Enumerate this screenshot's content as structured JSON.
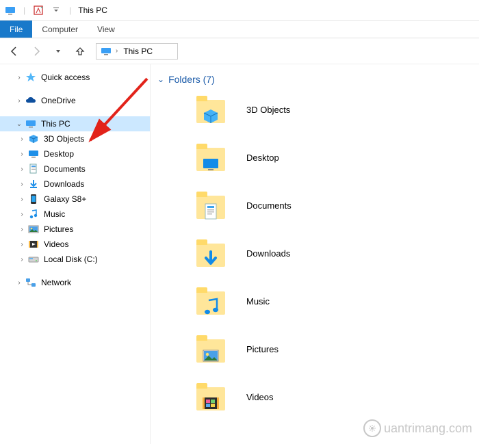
{
  "titlebar": {
    "title": "This PC"
  },
  "ribbon": {
    "file": "File",
    "tabs": [
      "Computer",
      "View"
    ]
  },
  "address": {
    "crumb": "This PC"
  },
  "tree": {
    "quick_access": "Quick access",
    "onedrive": "OneDrive",
    "this_pc": "This PC",
    "children": [
      {
        "label": "3D Objects",
        "icon": "3d"
      },
      {
        "label": "Desktop",
        "icon": "desktop"
      },
      {
        "label": "Documents",
        "icon": "documents"
      },
      {
        "label": "Downloads",
        "icon": "downloads"
      },
      {
        "label": "Galaxy S8+",
        "icon": "phone"
      },
      {
        "label": "Music",
        "icon": "music"
      },
      {
        "label": "Pictures",
        "icon": "pictures"
      },
      {
        "label": "Videos",
        "icon": "videos"
      },
      {
        "label": "Local Disk (C:)",
        "icon": "disk"
      }
    ],
    "network": "Network"
  },
  "content": {
    "section_title": "Folders (7)",
    "folders": [
      {
        "label": "3D Objects",
        "icon": "3d"
      },
      {
        "label": "Desktop",
        "icon": "desktop"
      },
      {
        "label": "Documents",
        "icon": "documents"
      },
      {
        "label": "Downloads",
        "icon": "downloads"
      },
      {
        "label": "Music",
        "icon": "music"
      },
      {
        "label": "Pictures",
        "icon": "pictures"
      },
      {
        "label": "Videos",
        "icon": "videos"
      }
    ]
  },
  "watermark": "uantrimang.com"
}
